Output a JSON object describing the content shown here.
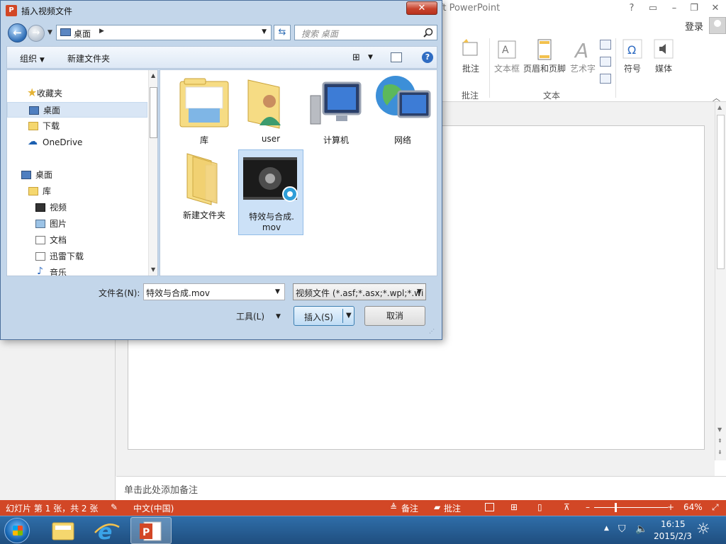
{
  "app": {
    "title_partial": "ft PowerPoint",
    "login": "登录"
  },
  "ribbon": {
    "buttons": [
      {
        "label": "批注"
      },
      {
        "label": "文本框"
      },
      {
        "label": "页眉和页脚"
      },
      {
        "label": "艺术字"
      },
      {
        "label": "符号"
      },
      {
        "label": "媒体"
      }
    ],
    "groups": {
      "comments": "批注",
      "text": "文本"
    }
  },
  "notes": {
    "placeholder": "单击此处添加备注"
  },
  "statusbar": {
    "slide_info": "幻灯片 第 1 张，共 2 张",
    "language": "中文(中国)",
    "notes_btn": "备注",
    "comments_btn": "批注",
    "zoom": "64%",
    "zoom_fraction": 0.64
  },
  "taskbar": {
    "time": "16:15",
    "date": "2015/2/3"
  },
  "dialog": {
    "title": "插入视频文件",
    "address": "桌面",
    "search_placeholder": "搜索 桌面",
    "toolbar": {
      "organize": "组织",
      "new_folder": "新建文件夹"
    },
    "nav": [
      {
        "label": "收藏夹"
      },
      {
        "label": "桌面"
      },
      {
        "label": "下载"
      },
      {
        "label": "OneDrive"
      },
      {
        "label": "桌面"
      },
      {
        "label": "库"
      },
      {
        "label": "视频"
      },
      {
        "label": "图片"
      },
      {
        "label": "文档"
      },
      {
        "label": "迅雷下载"
      },
      {
        "label": "音乐"
      }
    ],
    "files": [
      {
        "name": "库"
      },
      {
        "name": "user"
      },
      {
        "name": "计算机"
      },
      {
        "name": "网络"
      },
      {
        "name": "新建文件夹"
      },
      {
        "name_line1": "特效与合成.",
        "name_line2": "mov"
      }
    ],
    "filename_label": "文件名(N):",
    "filename_value": "特效与合成.mov",
    "filetype_value": "视频文件 (*.asf;*.asx;*.wpl;*.wi",
    "tools": "工具(L)",
    "insert": "插入(S)",
    "cancel": "取消"
  }
}
